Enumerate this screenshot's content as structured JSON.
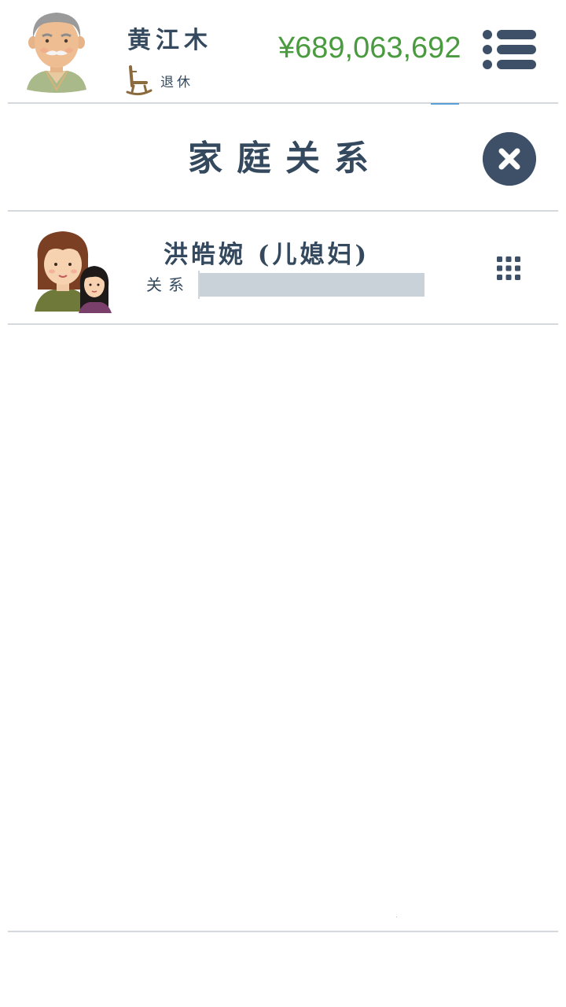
{
  "header": {
    "player_name": "黄江木",
    "status": "退休",
    "money": "¥689,063,692",
    "menu_icon": "list-menu-icon",
    "avatar_icon": "elderly-man-avatar",
    "status_icon": "rocking-chair-icon"
  },
  "panel": {
    "title": "家庭关系",
    "close_icon": "close-icon"
  },
  "relations": [
    {
      "name": "洪皓婉 (儿媳妇)",
      "relation_label": "关系",
      "relation_level": 0.0,
      "avatar_icon": "woman-with-daughter-avatar",
      "action_icon": "grid-menu-icon"
    }
  ],
  "colors": {
    "text": "#34495e",
    "money": "#4a9b3f",
    "close_bg": "#3d5068",
    "divider": "#d5d9dd",
    "bar": "#c9d1d9"
  }
}
